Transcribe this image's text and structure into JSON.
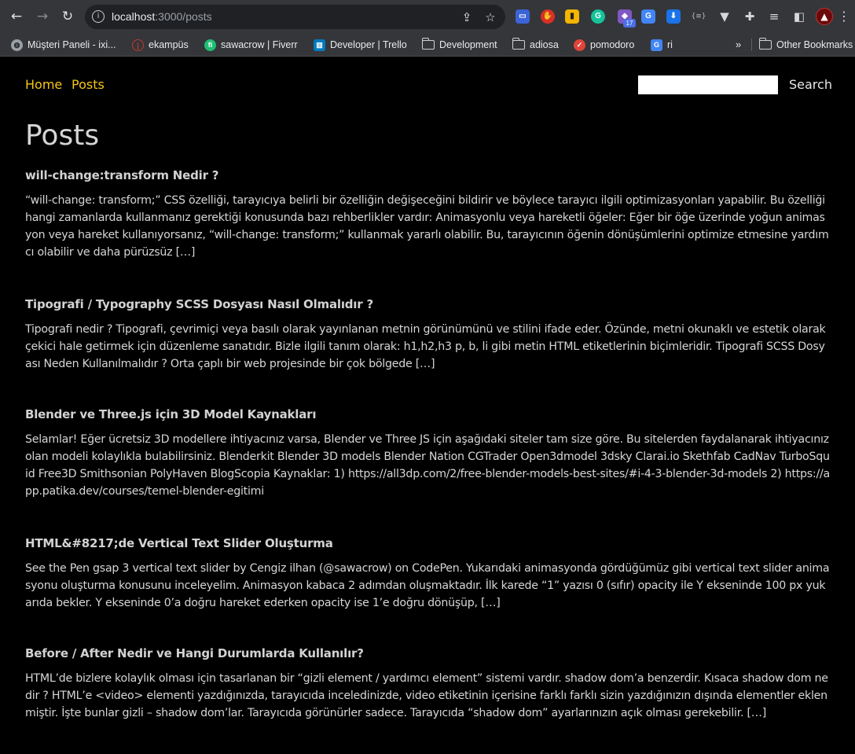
{
  "browser": {
    "url_host": "localhost",
    "url_path": ":3000/posts",
    "extension_badge": "17",
    "bookmarks": [
      {
        "label": "Müşteri Paneli - ixi...",
        "icon": "globe-icon",
        "color": "#9aa0a6"
      },
      {
        "label": "ekampüs",
        "icon": "ekampus-icon",
        "color": "#c0392b"
      },
      {
        "label": "sawacrow | Fiverr",
        "icon": "fiverr-icon",
        "color": "#1dbf73"
      },
      {
        "label": "Developer | Trello",
        "icon": "trello-icon",
        "color": "#0079bf"
      },
      {
        "label": "Development",
        "icon": "folder-icon"
      },
      {
        "label": "adiosa",
        "icon": "folder-icon"
      },
      {
        "label": "pomodoro",
        "icon": "pomodoro-icon",
        "color": "#e0453a"
      },
      {
        "label": "ri",
        "icon": "translate-icon",
        "color": "#4285f4"
      }
    ],
    "bookmarks_overflow": "»",
    "other_bookmarks": "Other Bookmarks"
  },
  "site": {
    "nav": [
      {
        "label": "Home"
      },
      {
        "label": "Posts"
      }
    ],
    "search_button": "Search",
    "search_value": "",
    "accent": "#f5c518"
  },
  "page_title": "Posts",
  "posts": [
    {
      "title": "will-change:transform Nedir ?",
      "excerpt": "“will-change: transform;” CSS özelliği, tarayıcıya belirli bir özelliğin değişeceğini bildirir ve böylece tarayıcı ilgili optimizasyonları yapabilir. Bu özelliği hangi zamanlarda kullanmanız gerektiği konusunda bazı rehberlikler vardır: Animasyonlu veya hareketli öğeler: Eğer bir öğe üzerinde yoğun animasyon veya hareket kullanıyorsanız, “will-change: transform;” kullanmak yararlı olabilir. Bu, tarayıcının öğenin dönüşümlerini optimize etmesine yardımcı olabilir ve daha pürüzsüz […]"
    },
    {
      "title": "Tipografi / Typography SCSS Dosyası Nasıl Olmalıdır ?",
      "excerpt": "  Tipografi nedir ? Tipografi, çevrimiçi veya basılı olarak yayınlanan metnin görünümünü ve stilini ifade eder. Özünde, metni okunaklı ve estetik olarak çekici hale getirmek için düzenleme sanatıdır. Bizle ilgili tanım olarak: h1,h2,h3 p, b, li gibi metin HTML etiketlerinin biçimleridir. Tipografi SCSS Dosyası Neden Kullanılmalıdır ? Orta çaplı bir web projesinde bir çok bölgede […]"
    },
    {
      "title": "Blender ve Three.js için 3D Model Kaynakları",
      "excerpt": "Selamlar! Eğer ücretsiz 3D modellere ihtiyacınız varsa, Blender ve Three JS için aşağıdaki siteler tam size göre. Bu sitelerden faydalanarak ihtiyacınız olan modeli kolaylıkla bulabilirsiniz. Blenderkit Blender 3D models Blender Nation CGTrader Open3dmodel 3dsky Clarai.io Skethfab CadNav TurboSquid Free3D Smithsonian PolyHaven BlogScopia   Kaynaklar: 1) https://all3dp.com/2/free-blender-models-best-sites/#i-4-3-blender-3d-models 2) https://app.patika.dev/courses/temel-blender-egitimi"
    },
    {
      "title": "HTML&#8217;de Vertical Text Slider Oluşturma",
      "excerpt": "See the Pen gsap 3 vertical text slider by Cengiz ilhan (@sawacrow) on CodePen. Yukarıdaki animasyonda gördüğümüz gibi vertical text slider animasyonu oluşturma konusunu inceleyelim. Animasyon kabaca 2 adımdan oluşmaktadır. İlk karede “1” yazısı 0 (sıfır) opacity ile Y ekseninde 100 px yukarıda bekler. Y ekseninde 0’a doğru hareket ederken  opacity ise 1’e doğru dönüşüp, […]"
    },
    {
      "title": "Before / After Nedir ve Hangi Durumlarda Kullanılır?",
      "excerpt": "  HTML’de bizlere kolaylık olması için tasarlanan bir “gizli element / yardımcı element” sistemi vardır. shadow dom’a benzerdir. Kısaca shadow dom nedir ? HTML’e <video> elementi yazdığınızda, tarayıcıda inceledinizde, video etiketinin içerisine farklı farklı sizin yazdığınızın dışında elementler eklenmiştir. İşte bunlar gizli – shadow dom’lar. Tarayıcıda görünürler sadece. Tarayıcıda “shadow dom” ayarlarınızın açık olması gerekebilir. […]"
    }
  ]
}
